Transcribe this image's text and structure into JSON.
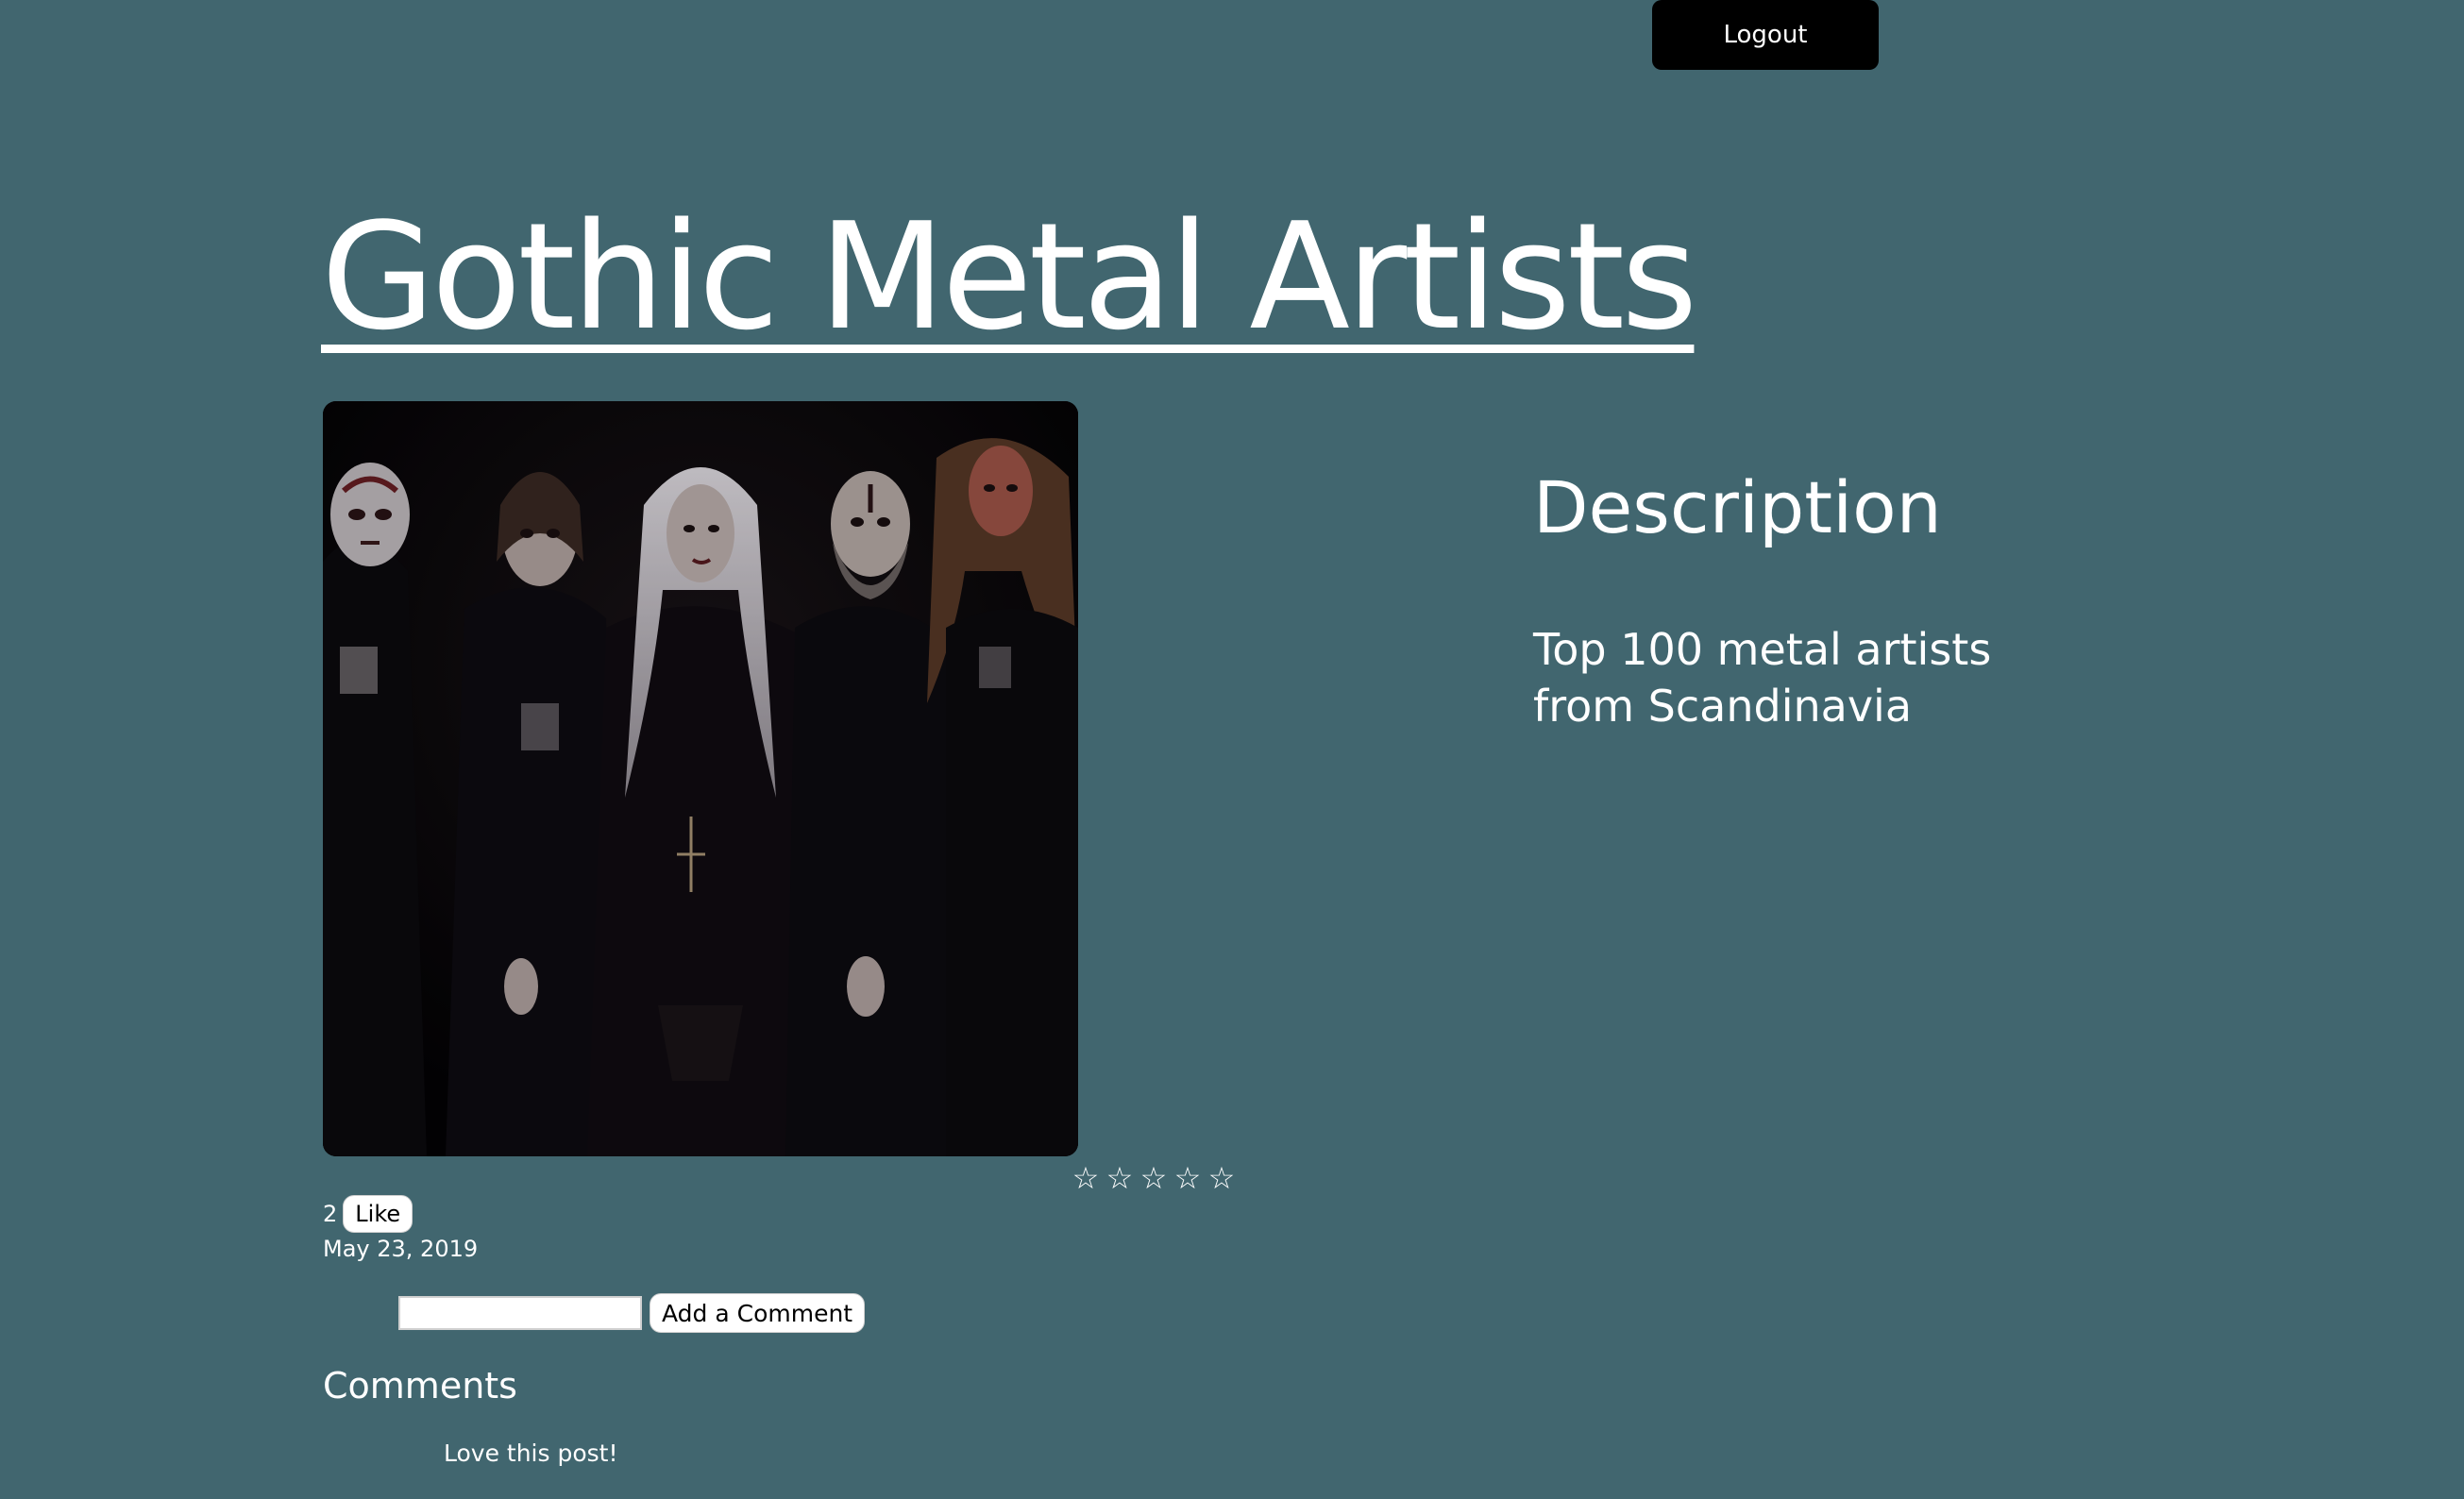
{
  "header": {
    "logout_label": "Logout"
  },
  "post": {
    "title": "Gothic Metal Artists",
    "image_alt": "Band photo of five gothic metal musicians in dark robes and corpse paint",
    "rating": {
      "stars": [
        "☆",
        "☆",
        "☆",
        "☆",
        "☆"
      ],
      "value": 0,
      "max": 5
    },
    "likes": {
      "count": "2",
      "button_label": "Like"
    },
    "date": "May 23, 2019",
    "comment_form": {
      "input_value": "",
      "input_placeholder": "",
      "button_label": "Add a Comment"
    },
    "comments": {
      "heading": "Comments",
      "items": [
        "Love this post!"
      ]
    }
  },
  "description": {
    "heading": "Description",
    "text": "Top 100 metal artists from Scandinavia"
  },
  "colors": {
    "background": "#41666f",
    "logout_button": "#000000",
    "text": "#ffffff"
  }
}
